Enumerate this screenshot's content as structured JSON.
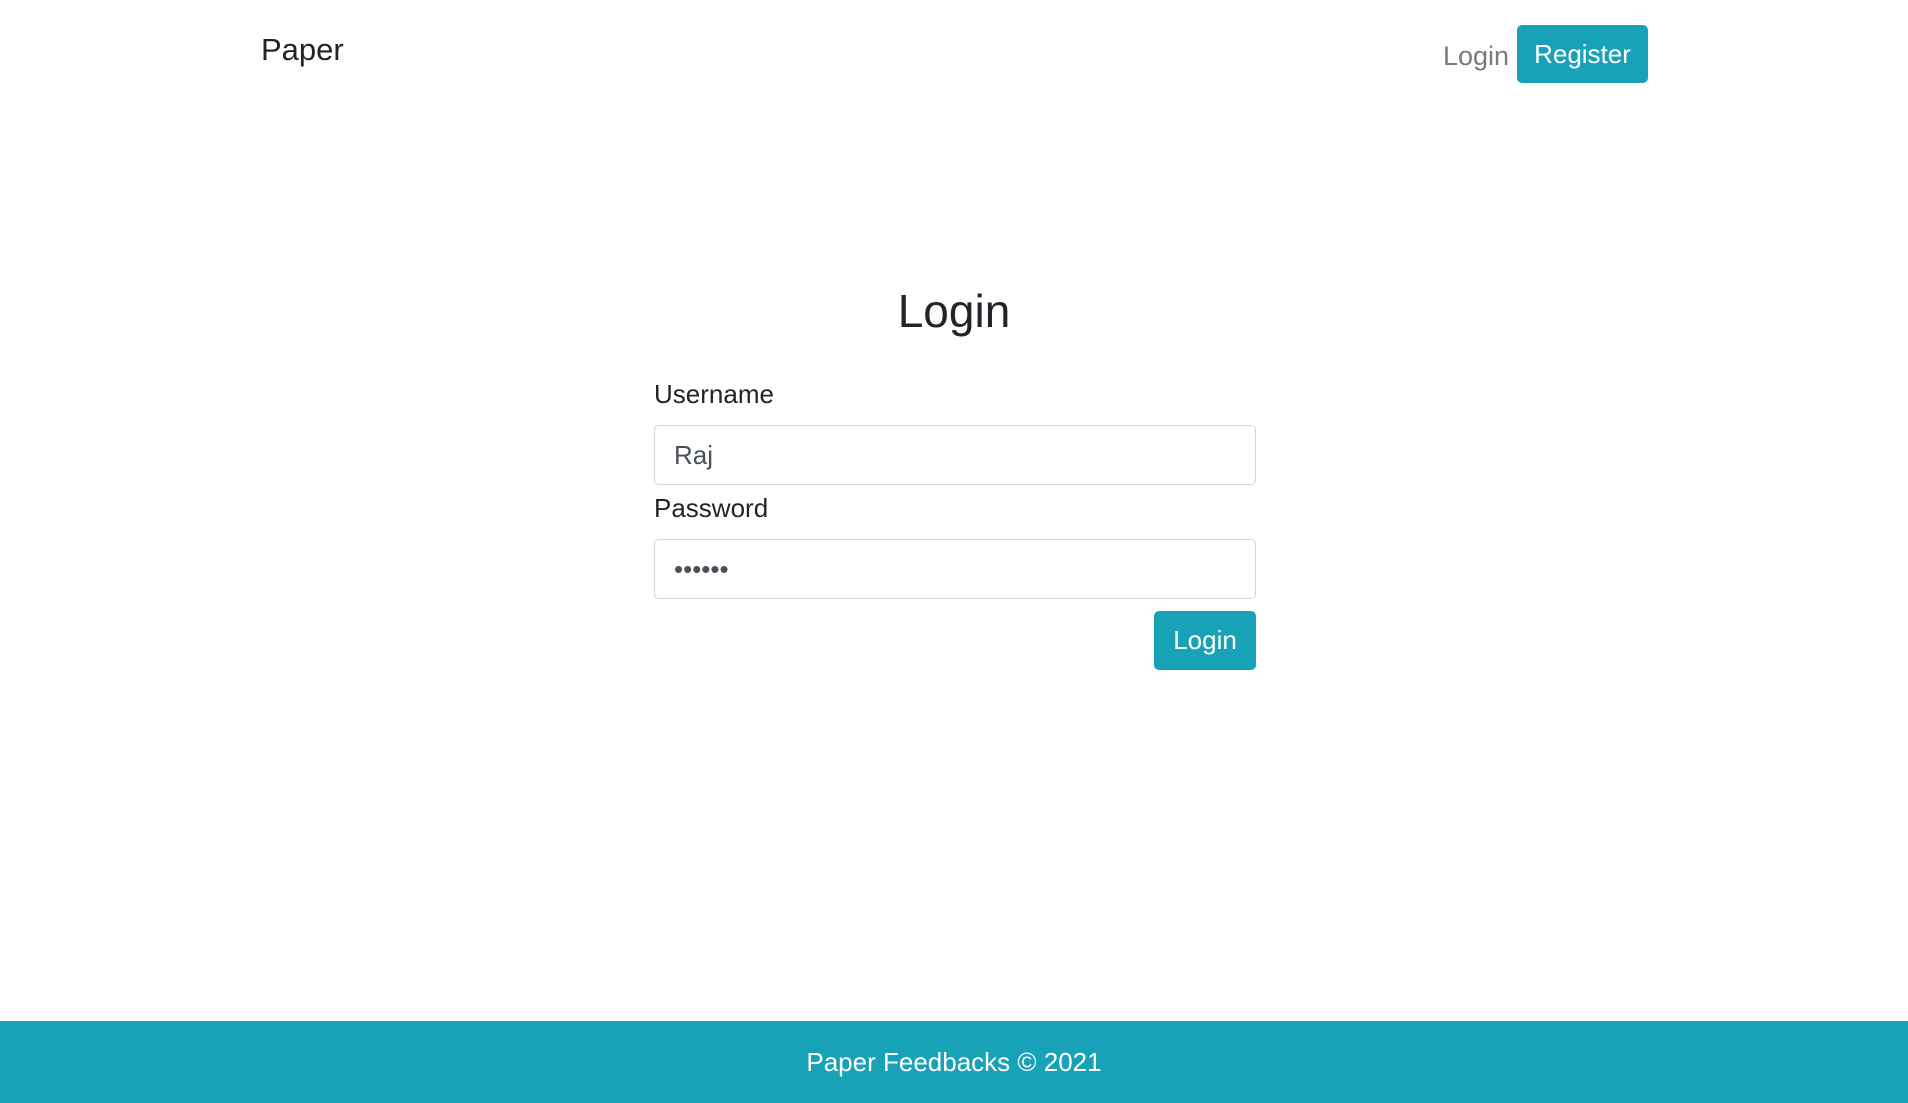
{
  "navbar": {
    "brand": "Paper",
    "login_link": "Login",
    "register_button": "Register"
  },
  "main": {
    "heading": "Login",
    "username": {
      "label": "Username",
      "value": "Raj"
    },
    "password": {
      "label": "Password",
      "value": "••••••"
    },
    "submit_label": "Login"
  },
  "footer": {
    "text": "Paper Feedbacks © 2021"
  },
  "colors": {
    "accent": "#17a2b8",
    "text": "#212529",
    "muted_link": "#7a7a7a"
  }
}
